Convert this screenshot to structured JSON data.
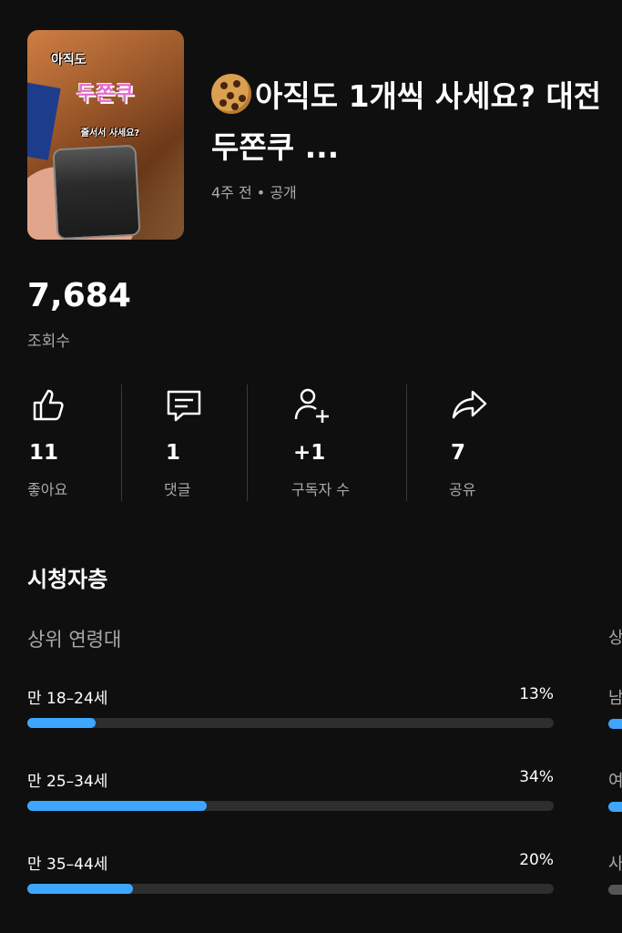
{
  "video": {
    "thumbnail": {
      "line1": "아직도",
      "line2": "두쫀쿠",
      "line3": "줄서서 사세요?"
    },
    "title": "아직도 1개씩 사세요? 대전 두쫀쿠 ...",
    "meta": "4주 전 • 공개",
    "title_icon": "cookie-emoji"
  },
  "views": {
    "value": "7,684",
    "label": "조회수"
  },
  "stats": [
    {
      "icon": "thumbs-up-icon",
      "value": "11",
      "label": "좋아요"
    },
    {
      "icon": "comment-icon",
      "value": "1",
      "label": "댓글"
    },
    {
      "icon": "add-subscriber-icon",
      "value": "+1",
      "label": "구독자 수"
    },
    {
      "icon": "share-icon",
      "value": "7",
      "label": "공유"
    }
  ],
  "audience": {
    "section_title": "시청자층",
    "age_title": "상위 연령대",
    "next_title_peek": "상",
    "colors": {
      "bar": "#3ea6ff",
      "track": "#2e2e2e"
    },
    "age_groups": [
      {
        "label": "만 18–24세",
        "percent_text": "13%",
        "percent": 13,
        "peek": "남"
      },
      {
        "label": "만 25–34세",
        "percent_text": "34%",
        "percent": 34,
        "peek": "여"
      },
      {
        "label": "만 35–44세",
        "percent_text": "20%",
        "percent": 20,
        "peek": "사"
      }
    ]
  }
}
